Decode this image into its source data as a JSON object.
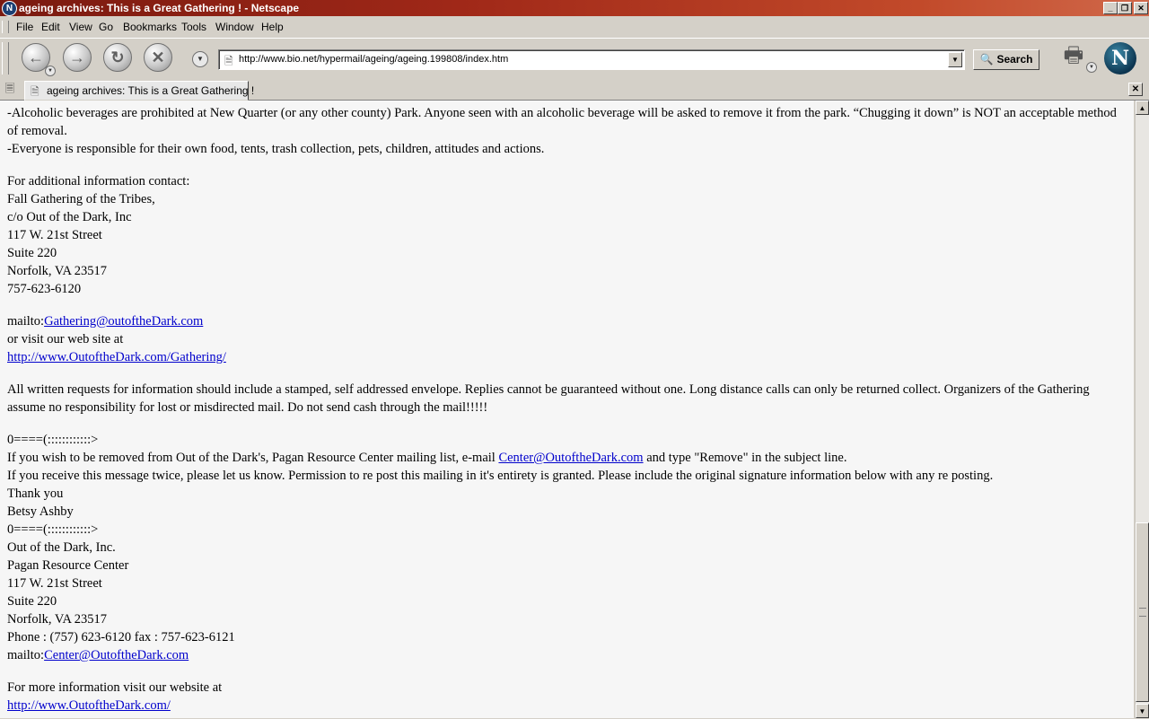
{
  "window": {
    "title": "ageing archives: This is a Great Gathering ! - Netscape",
    "app_icon": "netscape-n-icon"
  },
  "menu": {
    "items": [
      {
        "label": "File",
        "mnemonic": "F"
      },
      {
        "label": "Edit",
        "mnemonic": "E"
      },
      {
        "label": "View",
        "mnemonic": "V"
      },
      {
        "label": "Go",
        "mnemonic": "G"
      },
      {
        "label": "Bookmarks",
        "mnemonic": "B"
      },
      {
        "label": "Tools",
        "mnemonic": "T"
      },
      {
        "label": "Window",
        "mnemonic": "W"
      },
      {
        "label": "Help",
        "mnemonic": "H"
      }
    ]
  },
  "toolbar": {
    "url": "http://www.bio.net/hypermail/ageing/ageing.199808/index.htm",
    "search_label": "Search"
  },
  "tabs": [
    {
      "label": "ageing archives: This is a Great Gathering !",
      "active": true
    }
  ],
  "content": {
    "rules": [
      "-Alcoholic beverages are prohibited at New Quarter (or any other county) Park. Anyone seen with an alcoholic beverage will be asked to remove it from the park. “Chugging it down” is NOT an acceptable method of removal.",
      "-Everyone is responsible for their own food, tents, trash collection, pets, children, attitudes and actions."
    ],
    "contact_block": [
      "For additional information contact:",
      "Fall Gathering of the Tribes,",
      "c/o Out of the Dark, Inc",
      "117 W. 21st Street",
      "Suite 220",
      "Norfolk, VA 23517",
      "757-623-6120"
    ],
    "mailto_prefix": "mailto:",
    "gathering_email": "Gathering@outoftheDark.com",
    "visit_text": "or visit our web site at",
    "gathering_url": "http://www.OutoftheDark.com/Gathering/",
    "requests_paragraph": "All written requests for information should include a stamped, self addressed envelope. Replies cannot be guaranteed without one. Long distance calls can only be returned collect. Organizers of the Gathering assume no responsibility for lost or misdirected mail. Do not send cash through the mail!!!!!",
    "divider": "0====(::::::::::::>",
    "remove_prefix": "If you wish to be removed from Out of the Dark's, Pagan Resource Center mailing list, e-mail ",
    "remove_email": "Center@OutoftheDark.com",
    "remove_suffix": " and type \"Remove\" in the subject line.",
    "twice_line": "If you receive this message twice, please let us know. Permission to re post this mailing in it's entirety is granted. Please include the original signature information below with any re posting.",
    "thanks": "Thank you",
    "signer": "Betsy Ashby",
    "signature_block": [
      "Out of the Dark, Inc.",
      "Pagan Resource Center",
      "117 W. 21st Street",
      "Suite 220",
      "Norfolk, VA 23517",
      "Phone : (757) 623-6120 fax : 757-623-6121"
    ],
    "center_email": "Center@OutoftheDark.com",
    "more_info": "For more information visit our website at",
    "main_url": "http://www.OutoftheDark.com/"
  }
}
